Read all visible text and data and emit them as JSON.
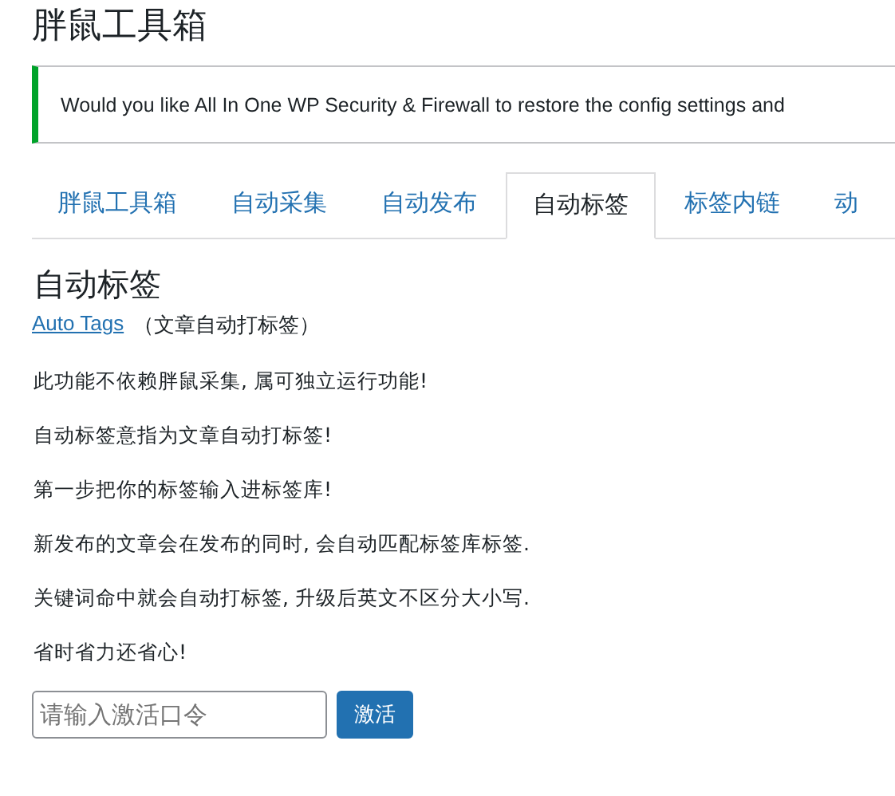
{
  "page_title": "胖鼠工具箱",
  "notice": {
    "text": "Would you like All In One WP Security & Firewall to restore the config settings and"
  },
  "tabs": [
    {
      "label": "胖鼠工具箱",
      "selected": false
    },
    {
      "label": "自动采集",
      "selected": false
    },
    {
      "label": "自动发布",
      "selected": false
    },
    {
      "label": "自动标签",
      "selected": true
    },
    {
      "label": "标签内链",
      "selected": false
    },
    {
      "label": "动",
      "selected": false
    }
  ],
  "section": {
    "heading": "自动标签",
    "link": "Auto Tags",
    "link_note": "（文章自动打标签）",
    "paragraphs": [
      "此功能不依赖胖鼠采集, 属可独立运行功能!",
      "自动标签意指为文章自动打标签!",
      "第一步把你的标签输入进标签库!",
      "新发布的文章会在发布的同时, 会自动匹配标签库标签.",
      "关键词命中就会自动打标签, 升级后英文不区分大小写.",
      "省时省力还省心!"
    ]
  },
  "activation": {
    "placeholder": "请输入激活口令",
    "button": "激活"
  }
}
